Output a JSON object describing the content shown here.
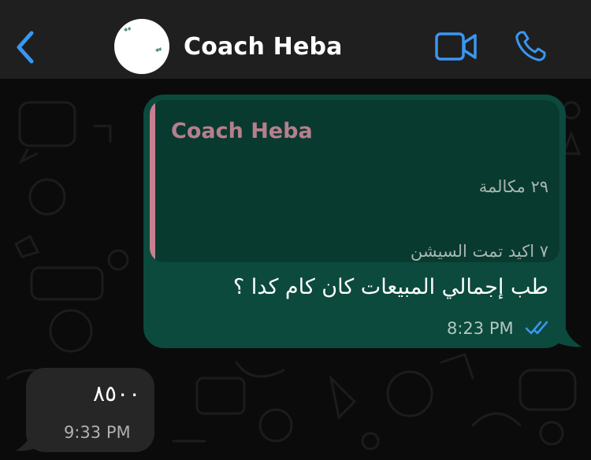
{
  "header": {
    "contact_name": "Coach Heba",
    "back_icon": "chevron-left-icon",
    "video_icon": "video-camera-icon",
    "call_icon": "phone-icon",
    "accent_color": "#3a97f0"
  },
  "messages": [
    {
      "direction": "outgoing",
      "quoted": {
        "author": "Coach Heba",
        "line1": "٢٩ مكالمة",
        "line2": "٧ اكيد تمت السيشن"
      },
      "text": "طب إجمالي المبيعات كان كام كدا ؟",
      "time": "8:23 PM",
      "status": "read",
      "bubble_color": "#0b4a3d"
    },
    {
      "direction": "incoming",
      "text": "٨٥٠٠",
      "time": "9:33 PM",
      "bubble_color": "#262626"
    }
  ]
}
